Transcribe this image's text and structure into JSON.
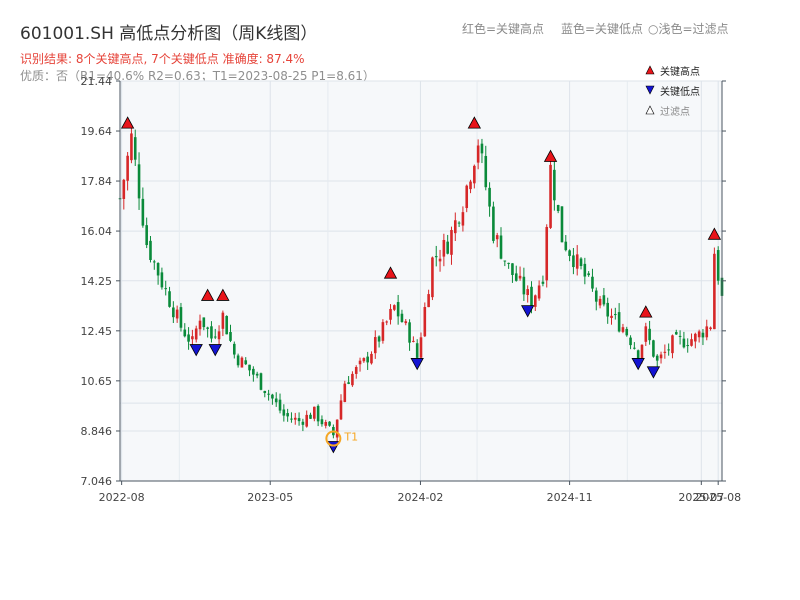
{
  "chart_data": {
    "type": "candlestick",
    "title": "601001.SH 高低点分析图（周K线图）",
    "subtitle_result": "识别结果: 8个关键高点, 7个关键低点  准确度: 87.4%",
    "subtitle_info": "优质：否（R1=40.6%  R2=0.63；T1=2023-08-25 P1=8.61）",
    "color_hint_red": "红色=关键高点",
    "color_hint_blue": "蓝色=关键低点",
    "color_hint_light": "○浅色=过滤点",
    "legend": {
      "high": "关键高点",
      "low": "关键低点",
      "filtered": "过滤点",
      "position": "top-right"
    },
    "ytick_labels": [
      "7.046",
      "8.846",
      "10.65",
      "12.45",
      "14.25",
      "16.04",
      "17.84",
      "19.64",
      "21.44"
    ],
    "ylim": [
      7.046,
      21.44
    ],
    "xtick_labels": [
      "2022-08",
      "2023-05",
      "2024-02",
      "2024-11",
      "2025-07",
      "2025-08"
    ],
    "xtick_dates": [
      "2022-08-01",
      "2023-05-01",
      "2024-02-01",
      "2024-11-01",
      "2025-07-01",
      "2025-08-01"
    ],
    "date_range": [
      "2022-07-29",
      "2025-08-08"
    ],
    "up_color": "#d62728",
    "down_color": "#0a8a3a",
    "high_marker_color": "#e8141a",
    "low_marker_color": "#1414d2",
    "t1_color": "#f5a623",
    "t1_label": "T1",
    "t1_point": {
      "date": "2023-08-25",
      "price": 8.61
    },
    "grid": true,
    "anchors": [
      [
        "2022-07-29",
        17.2
      ],
      [
        "2022-08-19",
        19.4
      ],
      [
        "2022-09-16",
        15.6
      ],
      [
        "2022-10-14",
        14.2
      ],
      [
        "2022-11-18",
        12.6
      ],
      [
        "2022-12-09",
        12.0
      ],
      [
        "2022-12-23",
        13.0
      ],
      [
        "2023-01-13",
        12.2
      ],
      [
        "2023-02-03",
        13.0
      ],
      [
        "2023-02-24",
        11.6
      ],
      [
        "2023-03-31",
        10.9
      ],
      [
        "2023-04-28",
        10.2
      ],
      [
        "2023-05-26",
        9.4
      ],
      [
        "2023-06-23",
        9.2
      ],
      [
        "2023-07-21",
        9.5
      ],
      [
        "2023-08-25",
        8.7
      ],
      [
        "2023-09-15",
        10.6
      ],
      [
        "2023-10-20",
        11.3
      ],
      [
        "2023-11-17",
        12.2
      ],
      [
        "2023-12-15",
        13.3
      ],
      [
        "2024-01-12",
        12.3
      ],
      [
        "2024-01-26",
        11.5
      ],
      [
        "2024-02-23",
        15.0
      ],
      [
        "2024-03-22",
        15.6
      ],
      [
        "2024-04-19",
        17.1
      ],
      [
        "2024-05-17",
        19.3
      ],
      [
        "2024-06-14",
        16.0
      ],
      [
        "2024-07-12",
        14.7
      ],
      [
        "2024-08-23",
        13.5
      ],
      [
        "2024-09-13",
        14.5
      ],
      [
        "2024-09-27",
        18.3
      ],
      [
        "2024-10-18",
        15.8
      ],
      [
        "2024-11-29",
        14.4
      ],
      [
        "2024-12-27",
        13.3
      ],
      [
        "2025-02-07",
        12.6
      ],
      [
        "2025-03-07",
        11.7
      ],
      [
        "2025-03-21",
        12.4
      ],
      [
        "2025-04-11",
        11.3
      ],
      [
        "2025-05-09",
        12.0
      ],
      [
        "2025-06-20",
        12.2
      ],
      [
        "2025-07-18",
        12.7
      ],
      [
        "2025-07-25",
        15.3
      ],
      [
        "2025-08-08",
        13.6
      ]
    ],
    "highs": [
      {
        "date": "2022-08-12",
        "price": 19.6
      },
      {
        "date": "2023-01-06",
        "price": 13.4
      },
      {
        "date": "2023-02-03",
        "price": 13.4
      },
      {
        "date": "2023-12-08",
        "price": 14.2
      },
      {
        "date": "2024-05-10",
        "price": 19.6
      },
      {
        "date": "2024-09-27",
        "price": 18.4
      },
      {
        "date": "2025-03-21",
        "price": 12.8
      },
      {
        "date": "2025-07-25",
        "price": 15.6
      }
    ],
    "lows": [
      {
        "date": "2022-12-16",
        "price": 12.1
      },
      {
        "date": "2023-01-20",
        "price": 12.1
      },
      {
        "date": "2023-08-25",
        "price": 8.61
      },
      {
        "date": "2024-01-26",
        "price": 11.6
      },
      {
        "date": "2024-08-16",
        "price": 13.5
      },
      {
        "date": "2025-03-07",
        "price": 11.6
      },
      {
        "date": "2025-04-04",
        "price": 11.3
      }
    ]
  }
}
